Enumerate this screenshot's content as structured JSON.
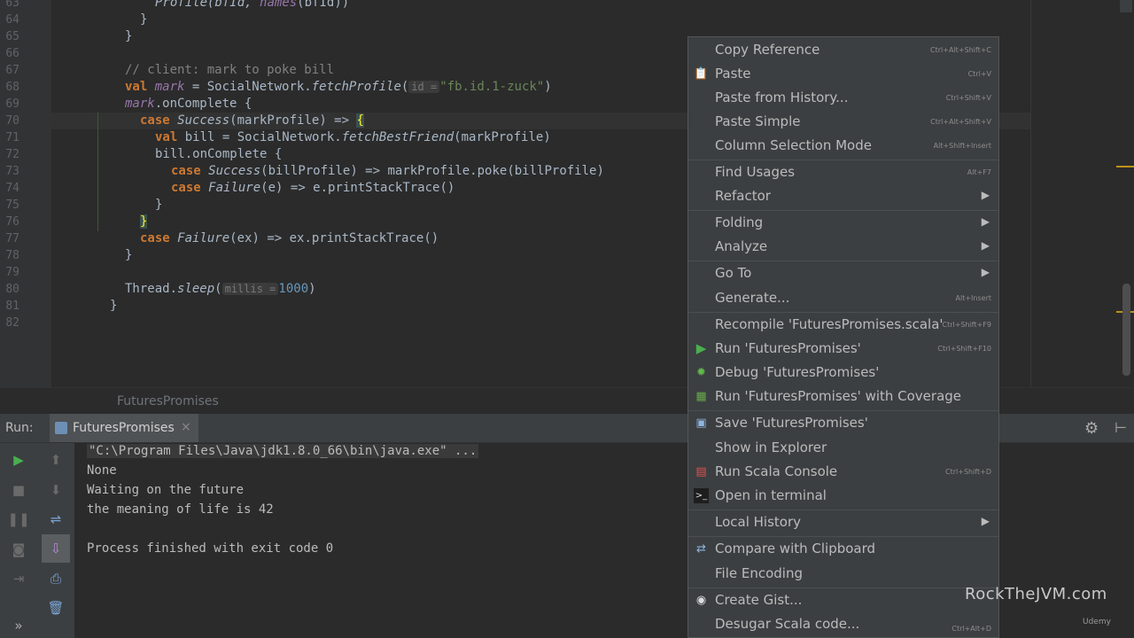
{
  "editor": {
    "line_numbers": [
      "63",
      "64",
      "65",
      "66",
      "67",
      "68",
      "69",
      "70",
      "71",
      "72",
      "73",
      "74",
      "75",
      "76",
      "77",
      "78",
      "79",
      "80",
      "81",
      "82"
    ],
    "code": {
      "l63_a": "Profile(bfId, ",
      "l63_b": "names",
      "l63_c": "(bfId))",
      "l64": "}",
      "l65": "}",
      "l67": "// client: mark to poke bill",
      "l68_kw": "val ",
      "l68_var": "mark",
      "l68_eq": " = SocialNetwork.",
      "l68_fn": "fetchProfile",
      "l68_p": "(",
      "l68_hint": "id =",
      "l68_str": "\"fb.id.1-zuck\"",
      "l68_end": ")",
      "l69_var": "mark",
      "l69_rest": ".onComplete {",
      "l70_kw": "case ",
      "l70_cls": "Success",
      "l70_rest": "(markProfile) => ",
      "l70_brace": "{",
      "l71_kw": "val ",
      "l71_a": "bill = SocialNetwork.",
      "l71_fn": "fetchBestFriend",
      "l71_b": "(markProfile)",
      "l72": "bill.onComplete {",
      "l73_kw": "case ",
      "l73_cls": "Success",
      "l73_rest": "(billProfile) => markProfile.poke(billProfile)",
      "l74_kw": "case ",
      "l74_cls": "Failure",
      "l74_rest": "(e) => e.printStackTrace()",
      "l75": "}",
      "l76": "}",
      "l77_kw": "case ",
      "l77_cls": "Failure",
      "l77_rest": "(ex) => ex.printStackTrace()",
      "l78": "}",
      "l80_a": "Thread.",
      "l80_fn": "sleep",
      "l80_p": "(",
      "l80_hint": "millis =",
      "l80_num": "1000",
      "l80_end": ")",
      "l81": "}"
    }
  },
  "breadcrumb": "FuturesPromises",
  "run_panel": {
    "label": "Run:",
    "tab_label": "FuturesPromises",
    "tab_close": "×",
    "console_lines": [
      "\"C:\\Program Files\\Java\\jdk1.8.0_66\\bin\\java.exe\" ...",
      "None",
      "Waiting on the future",
      "the meaning of life is 42",
      "",
      "Process finished with exit code 0"
    ]
  },
  "context_menu": {
    "items": [
      {
        "label": "Copy Reference",
        "shortcut": "Ctrl+Alt+Shift+C"
      },
      {
        "label": "Paste",
        "shortcut": "Ctrl+V",
        "icon": "clipboard-icon"
      },
      {
        "label": "Paste from History...",
        "shortcut": "Ctrl+Shift+V"
      },
      {
        "label": "Paste Simple",
        "shortcut": "Ctrl+Alt+Shift+V"
      },
      {
        "label": "Column Selection Mode",
        "shortcut": "Alt+Shift+Insert"
      },
      {
        "label": "Find Usages",
        "shortcut": "Alt+F7"
      },
      {
        "label": "Refactor",
        "submenu": true
      },
      {
        "label": "Folding",
        "submenu": true
      },
      {
        "label": "Analyze",
        "submenu": true
      },
      {
        "label": "Go To",
        "submenu": true
      },
      {
        "label": "Generate...",
        "shortcut": "Alt+Insert"
      },
      {
        "label": "Recompile 'FuturesPromises.scala'",
        "shortcut": "Ctrl+Shift+F9"
      },
      {
        "label": "Run 'FuturesPromises'",
        "shortcut": "Ctrl+Shift+F10",
        "icon": "run-icon"
      },
      {
        "label": "Debug 'FuturesPromises'",
        "icon": "debug-icon"
      },
      {
        "label": "Run 'FuturesPromises' with Coverage",
        "icon": "coverage-icon"
      },
      {
        "label": "Save 'FuturesPromises'",
        "icon": "save-icon"
      },
      {
        "label": "Show in Explorer"
      },
      {
        "label": "Run Scala Console",
        "shortcut": "Ctrl+Shift+D",
        "icon": "scala-console-icon"
      },
      {
        "label": "Open in terminal",
        "icon": "terminal-icon"
      },
      {
        "label": "Local History",
        "submenu": true
      },
      {
        "label": "Compare with Clipboard",
        "icon": "compare-icon"
      },
      {
        "label": "File Encoding"
      },
      {
        "label": "Create Gist...",
        "icon": "github-icon"
      },
      {
        "label": "Desugar Scala code...",
        "shortcut": "Ctrl+Alt+D"
      }
    ]
  },
  "watermark": "RockTheJVM.com",
  "udemy": "Udemy",
  "colors": {
    "keyword": "#cc7832",
    "string": "#6a8759",
    "number": "#6897bb",
    "comment": "#808080",
    "menu_bg": "#3c3f41",
    "run_green": "#4caf50"
  }
}
